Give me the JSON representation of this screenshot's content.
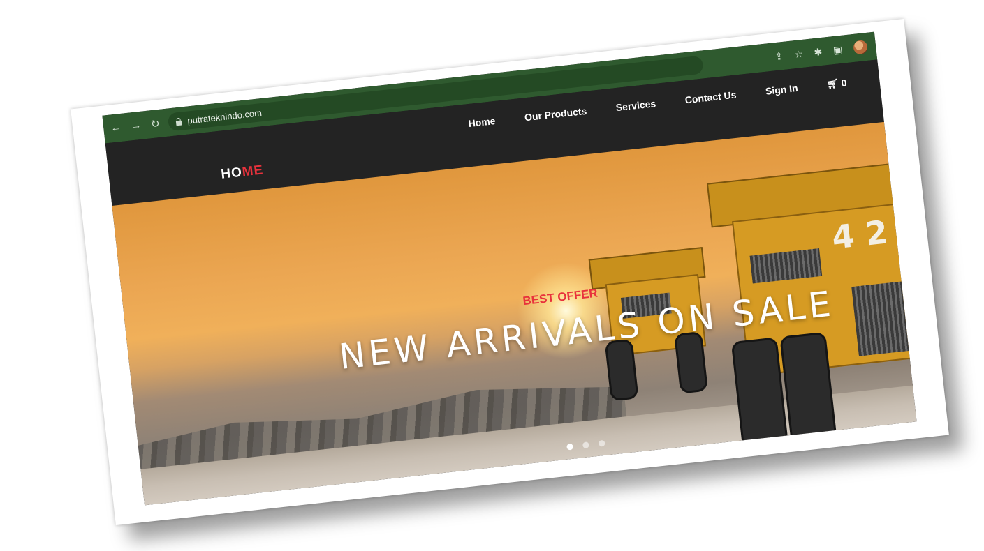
{
  "browser": {
    "url": "putrateknindo.com"
  },
  "site": {
    "logo_main": "HO",
    "logo_accent": "ME",
    "menu": [
      "Home",
      "Our Products",
      "Services",
      "Contact Us",
      "Sign In"
    ],
    "cart_count": "0"
  },
  "hero": {
    "eyebrow": "BEST OFFER",
    "headline": "NEW ARRIVALS ON SALE",
    "truck_number": "4 2",
    "slides_total": 3,
    "active_slide": 1
  },
  "colors": {
    "browser_bar": "#2f5a2f",
    "header_bg": "#232323",
    "accent_red": "#e8323c"
  },
  "icons": [
    "back-icon",
    "forward-icon",
    "reload-icon",
    "lock-icon",
    "share-icon",
    "star-icon",
    "extensions-icon",
    "sidebar-icon",
    "profile-avatar",
    "cart-icon"
  ]
}
